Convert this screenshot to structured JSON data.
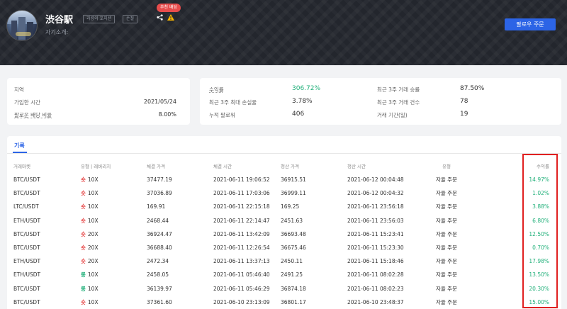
{
  "header": {
    "name": "渋谷駅",
    "intro": "자기소개:",
    "tags": [
      "과량의 포지션",
      "손절"
    ],
    "badge": "추천 배당",
    "follow_label": "팔로우 주문",
    "icons": [
      "share-icon",
      "warning-icon"
    ]
  },
  "profile": {
    "region_label": "지역",
    "region_value": "",
    "joined_label": "가입한 시간",
    "joined_value": "2021/05/24",
    "share_ratio_label": "팔로운 배당 비율",
    "share_ratio_value": "8.00%"
  },
  "stats": {
    "return_label": "수익률",
    "return_value": "306.72%",
    "drawdown_label": "최근 3주 최대 손실율",
    "drawdown_value": "3.78%",
    "followers_label": "누적 팔로워",
    "followers_value": "406",
    "winrate_label": "최근 3주 거래 승률",
    "winrate_value": "87.50%",
    "trades_label": "최근 3주 거래 건수",
    "trades_value": "78",
    "period_label": "거래 기간(일)",
    "period_value": "19"
  },
  "history": {
    "tab": "기록",
    "columns": [
      "거래마켓",
      "유형 | 레버리지",
      "체결 가격",
      "체결 시간",
      "청산 가격",
      "청산 시간",
      "유형",
      "수익률"
    ],
    "rows": [
      {
        "market": "BTC/USDT",
        "dir": "숏",
        "lev": "10X",
        "entry": "37477.19",
        "entry_time": "2021-06-11 19:06:52",
        "exit": "36915.51",
        "exit_time": "2021-06-12 00:04:48",
        "type": "자율 주문",
        "pnl": "14.97%"
      },
      {
        "market": "BTC/USDT",
        "dir": "숏",
        "lev": "10X",
        "entry": "37036.89",
        "entry_time": "2021-06-11 17:03:06",
        "exit": "36999.11",
        "exit_time": "2021-06-12 00:04:32",
        "type": "자율 주문",
        "pnl": "1.02%"
      },
      {
        "market": "LTC/USDT",
        "dir": "숏",
        "lev": "10X",
        "entry": "169.91",
        "entry_time": "2021-06-11 22:15:18",
        "exit": "169.25",
        "exit_time": "2021-06-11 23:56:18",
        "type": "자율 주문",
        "pnl": "3.88%"
      },
      {
        "market": "ETH/USDT",
        "dir": "숏",
        "lev": "10X",
        "entry": "2468.44",
        "entry_time": "2021-06-11 22:14:47",
        "exit": "2451.63",
        "exit_time": "2021-06-11 23:56:03",
        "type": "자율 주문",
        "pnl": "6.80%"
      },
      {
        "market": "BTC/USDT",
        "dir": "숏",
        "lev": "20X",
        "entry": "36924.47",
        "entry_time": "2021-06-11 13:42:09",
        "exit": "36693.48",
        "exit_time": "2021-06-11 15:23:41",
        "type": "자율 주문",
        "pnl": "12.50%"
      },
      {
        "market": "BTC/USDT",
        "dir": "숏",
        "lev": "20X",
        "entry": "36688.40",
        "entry_time": "2021-06-11 12:26:54",
        "exit": "36675.46",
        "exit_time": "2021-06-11 15:23:30",
        "type": "자율 주문",
        "pnl": "0.70%"
      },
      {
        "market": "ETH/USDT",
        "dir": "숏",
        "lev": "20X",
        "entry": "2472.34",
        "entry_time": "2021-06-11 13:37:13",
        "exit": "2450.11",
        "exit_time": "2021-06-11 15:18:46",
        "type": "자율 주문",
        "pnl": "17.98%"
      },
      {
        "market": "ETH/USDT",
        "dir": "롱",
        "lev": "10X",
        "entry": "2458.05",
        "entry_time": "2021-06-11 05:46:40",
        "exit": "2491.25",
        "exit_time": "2021-06-11 08:02:28",
        "type": "자율 주문",
        "pnl": "13.50%"
      },
      {
        "market": "BTC/USDT",
        "dir": "롱",
        "lev": "10X",
        "entry": "36139.97",
        "entry_time": "2021-06-11 05:46:29",
        "exit": "36874.18",
        "exit_time": "2021-06-11 08:02:23",
        "type": "자율 주문",
        "pnl": "20.30%"
      },
      {
        "market": "BTC/USDT",
        "dir": "숏",
        "lev": "10X",
        "entry": "37361.60",
        "entry_time": "2021-06-10 23:13:09",
        "exit": "36801.17",
        "exit_time": "2021-06-10 23:48:37",
        "type": "자율 주문",
        "pnl": "15.00%"
      }
    ]
  },
  "colors": {
    "accent": "#2c64e6",
    "short": "#e74c4c",
    "long": "#21b07a",
    "highlight": "#e02020"
  }
}
